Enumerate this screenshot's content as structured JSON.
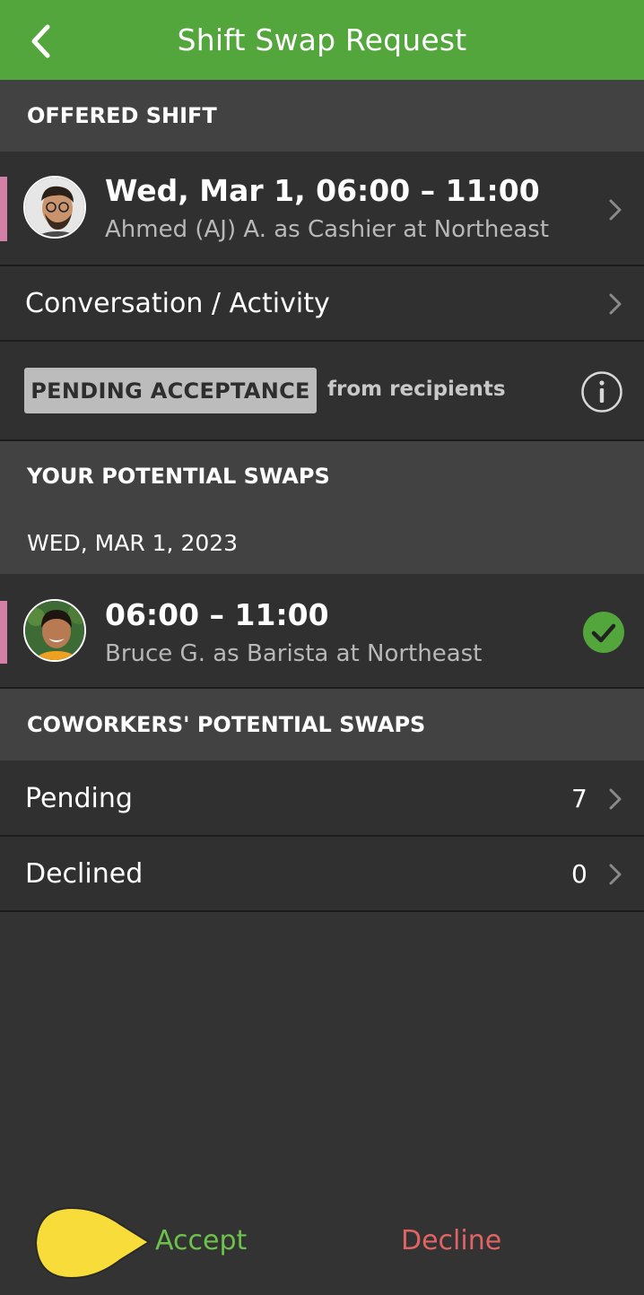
{
  "header": {
    "title": "Shift Swap Request",
    "background": "#52a63c"
  },
  "offered_shift": {
    "section_title": "OFFERED SHIFT",
    "shift_time": "Wed, Mar 1, 06:00 – 11:00",
    "shift_details": "Ahmed (AJ) A. as Cashier at Northeast",
    "conversation_label": "Conversation / Activity",
    "status_badge": "PENDING ACCEPTANCE",
    "status_suffix": "from recipients"
  },
  "your_swaps": {
    "section_title": "YOUR POTENTIAL SWAPS",
    "date_label": "WED, MAR 1, 2023",
    "items": [
      {
        "time": "06:00 – 11:00",
        "details": "Bruce G. as Barista at Northeast",
        "selected": true
      }
    ]
  },
  "coworkers_swaps": {
    "section_title": "COWORKERS' POTENTIAL SWAPS",
    "rows": [
      {
        "label": "Pending",
        "count": "7"
      },
      {
        "label": "Declined",
        "count": "0"
      }
    ]
  },
  "actions": {
    "accept_label": "Accept",
    "decline_label": "Decline",
    "accept_color": "#6cc24a",
    "decline_color": "#e06464"
  },
  "icons": {
    "back": "chevron-left-icon",
    "chevron": "chevron-right-icon",
    "info": "info-icon",
    "check": "check-circle-icon"
  }
}
